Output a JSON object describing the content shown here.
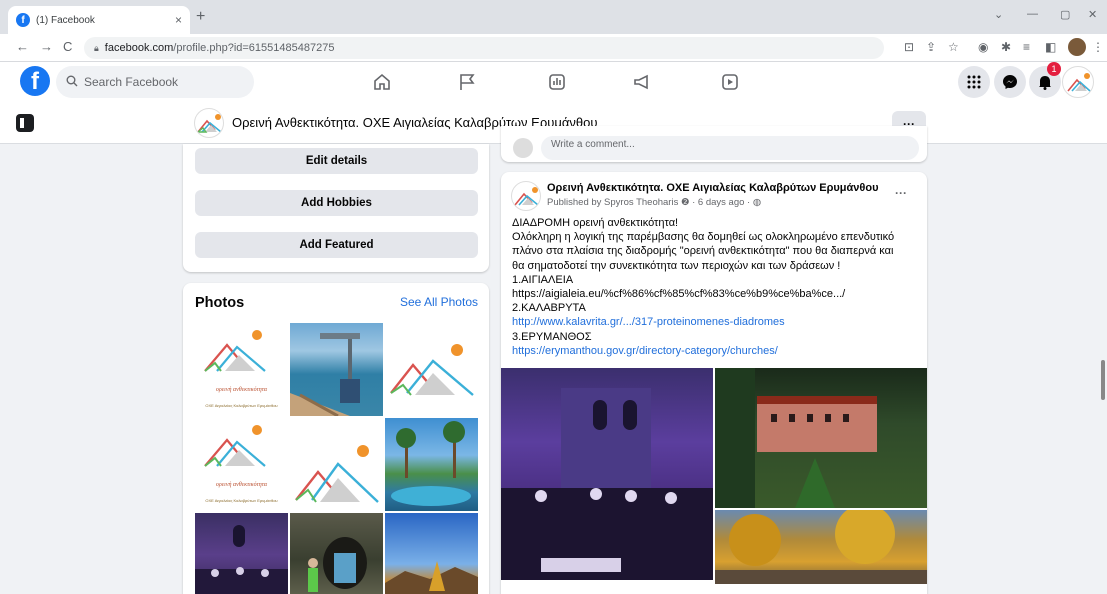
{
  "browser": {
    "tab_title": "(1) Facebook",
    "tab_close": "×",
    "new_tab": "+",
    "url_host": "facebook.com",
    "url_path": "/profile.php?id=61551485487275",
    "back": "←",
    "forward": "→",
    "reload": "C",
    "window_min": "—",
    "window_max": "▢",
    "window_close": "✕",
    "chevron": "⌄"
  },
  "fb_header": {
    "logo": "f",
    "search_placeholder": "Search Facebook",
    "notification_count": "1"
  },
  "profile": {
    "name": "Ορεινή Ανθεκτικότητα. ΟΧΕ Αιγιαλείας Καλαβρύτων Ερυμάνθου",
    "more": "···"
  },
  "left_buttons": [
    "Edit details",
    "Add Hobbies",
    "Add Featured"
  ],
  "photos": {
    "title": "Photos",
    "see_all": "See All Photos",
    "logo_caption_1": "ορεινή ανθεκτικότητα",
    "logo_caption_2": "ΟΧΕ Αιγιαλείας Καλαβρύτων Ερυμάνθου"
  },
  "comment_box": {
    "placeholder": "Write a comment..."
  },
  "post": {
    "author": "Ορεινή Ανθεκτικότητα. ΟΧΕ Αιγιαλείας Καλαβρύτων Ερυμάνθου",
    "meta": "Published by Spyros Theoharis ❷ · 6 days ago · ◍",
    "more": "···",
    "lines": [
      "ΔΙΑΔΡΟΜΗ ορεινή ανθεκτικότητα!",
      "Ολόκληρη η λογική της παρέμβασης θα δομηθεί ως ολοκληρωμένο επενδυτικό",
      "πλάνο στα πλαίσια της διαδρομής \"ορεινή ανθεκτικότητα\" που θα διαπερνά και",
      "θα σηματοδοτεί την συνεκτικότητα των περιοχών και των δράσεων !",
      "1.ΑΙΓΙΑΛΕΙΑ",
      "https://aigialeia.eu/%cf%86%cf%85%cf%83%ce%b9%ce%ba%ce.../",
      "2.ΚΑΛΑΒΡΥΤΑ"
    ],
    "link_kalavrita": "http://www.kalavrita.gr/.../317-proteinomenes-diadromes",
    "line_erymanthos": "3.ΕΡΥΜΑΝΘΟΣ",
    "link_erymanthou": "https://erymanthou.gov.gr/directory-category/churches/"
  },
  "colors": {
    "fb_blue": "#1877f2",
    "link": "#216fdb",
    "badge_red": "#e41e3f",
    "bg": "#f0f2f5"
  },
  "icons": [
    "home-icon",
    "flag-icon",
    "ads-icon",
    "megaphone-icon",
    "video-icon",
    "menu-grid-icon",
    "messenger-icon",
    "bell-icon"
  ]
}
